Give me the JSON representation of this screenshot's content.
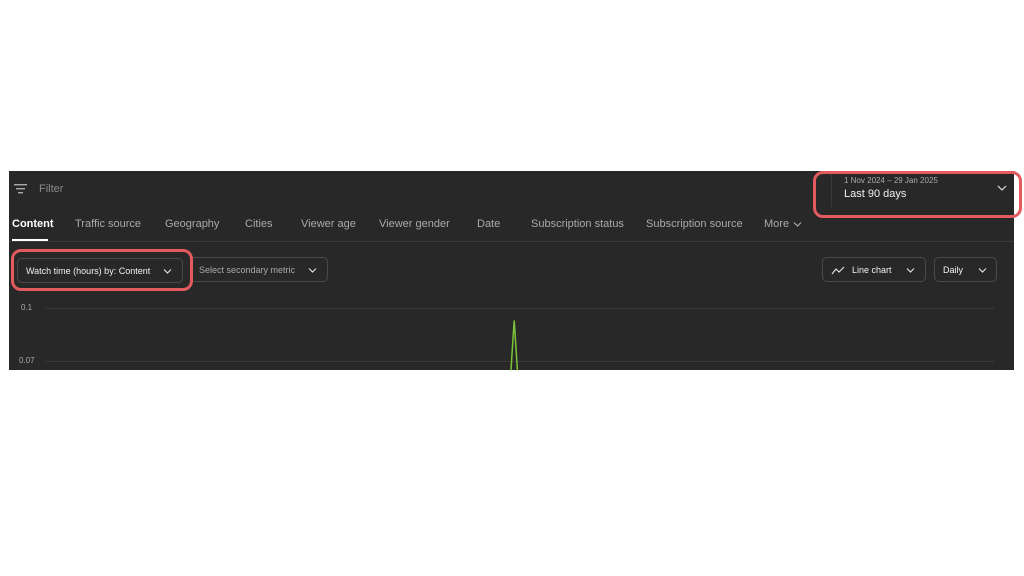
{
  "filter": {
    "placeholder": "Filter",
    "icon": "filter-icon"
  },
  "date_picker": {
    "range": "1 Nov 2024 – 29 Jan 2025",
    "label": "Last 90 days"
  },
  "tabs": [
    {
      "label": "Content",
      "active": true
    },
    {
      "label": "Traffic source",
      "active": false
    },
    {
      "label": "Geography",
      "active": false
    },
    {
      "label": "Cities",
      "active": false
    },
    {
      "label": "Viewer age",
      "active": false
    },
    {
      "label": "Viewer gender",
      "active": false
    },
    {
      "label": "Date",
      "active": false
    },
    {
      "label": "Subscription status",
      "active": false
    },
    {
      "label": "Subscription source",
      "active": false
    },
    {
      "label": "More",
      "active": false
    }
  ],
  "controls": {
    "primary_metric": "Watch time (hours) by: Content",
    "secondary_metric": "Select secondary metric",
    "chart_type": "Line chart",
    "interval": "Daily"
  },
  "colors": {
    "background": "#282828",
    "line": "#7cc33a",
    "annotation": "#e35a5f"
  },
  "chart_data": {
    "type": "line",
    "y_ticks": [
      "0.1",
      "0.07"
    ],
    "series": [
      {
        "values": [
          0,
          0,
          0,
          0,
          0,
          0,
          0,
          0,
          0,
          0,
          0,
          0,
          0,
          0,
          0,
          0,
          0,
          0,
          0,
          0,
          0,
          0,
          0,
          0,
          0,
          0,
          0,
          0,
          0,
          0,
          0,
          0,
          0,
          0,
          0,
          0,
          0,
          0,
          0,
          0,
          0,
          0,
          0,
          0,
          0.093,
          0,
          0,
          0,
          0,
          0,
          0,
          0,
          0,
          0,
          0,
          0,
          0,
          0,
          0,
          0,
          0,
          0,
          0,
          0,
          0,
          0,
          0,
          0,
          0,
          0,
          0,
          0,
          0,
          0,
          0,
          0,
          0,
          0,
          0,
          0,
          0,
          0,
          0,
          0,
          0,
          0,
          0,
          0,
          0,
          0
        ]
      }
    ]
  }
}
